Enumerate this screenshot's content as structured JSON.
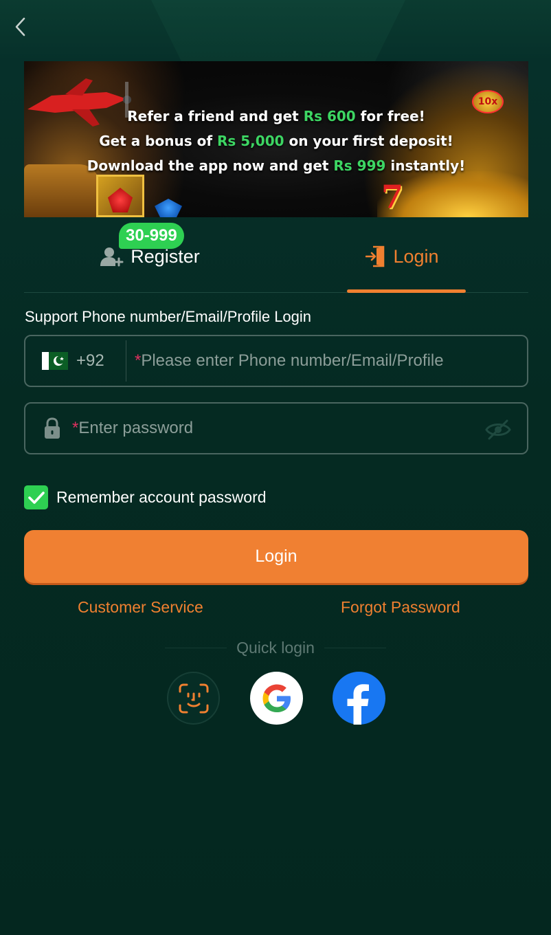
{
  "header": {
    "back_icon": "chevron-left-icon"
  },
  "banner": {
    "line1": {
      "pre": "Refer a friend and get ",
      "highlight": "Rs 600",
      "post": " for free!"
    },
    "line2": {
      "pre": "Get a bonus of ",
      "highlight": "Rs 5,000",
      "post": " on your first deposit!"
    },
    "line3": {
      "pre": "Download the app now and get ",
      "highlight": "Rs 999",
      "post": " instantly!"
    },
    "badge": "10x"
  },
  "tabs": {
    "register": {
      "label": "Register",
      "badge": "30-999",
      "icon": "add-user-icon"
    },
    "login": {
      "label": "Login",
      "icon": "login-door-icon",
      "active": true
    }
  },
  "form": {
    "support_label": "Support Phone number/Email/Profile Login",
    "phone": {
      "country_code": "+92",
      "required_mark": "*",
      "placeholder": "Please enter Phone number/Email/Profile",
      "flag": "pakistan-flag-icon"
    },
    "password": {
      "required_mark": "*",
      "placeholder": "Enter password",
      "icon": "lock-icon",
      "toggle_icon": "eye-off-icon"
    },
    "remember": {
      "label": "Remember account password",
      "checked": true
    },
    "submit_label": "Login"
  },
  "links": {
    "customer_service": "Customer Service",
    "forgot_password": "Forgot Password"
  },
  "quick_login": {
    "label": "Quick login",
    "options": [
      "face-id-icon",
      "google-icon",
      "facebook-icon"
    ]
  },
  "colors": {
    "accent": "#f08030",
    "green": "#2ed052",
    "background": "#052a22"
  }
}
